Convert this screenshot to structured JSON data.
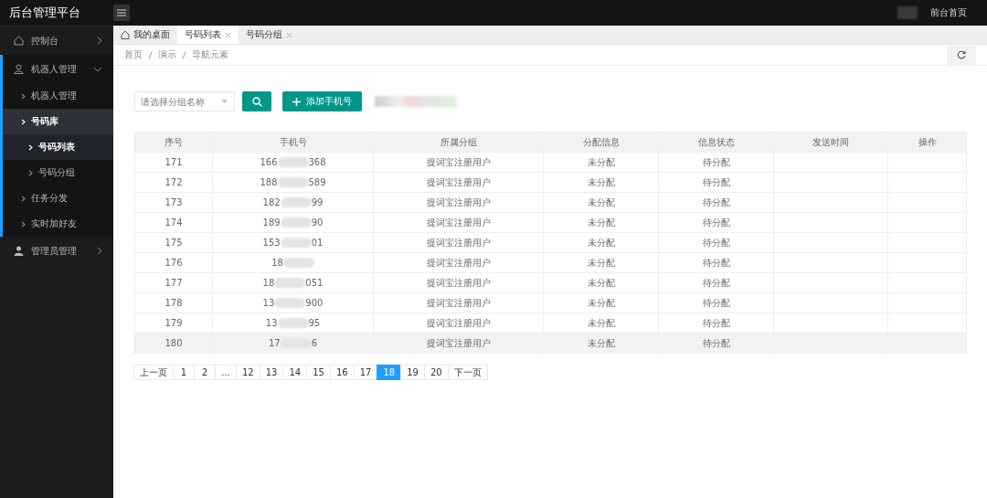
{
  "app": {
    "title": "后台管理平台",
    "top_link": "前台首页"
  },
  "sidebar": {
    "items": [
      {
        "label": "控制台",
        "expanded": false
      },
      {
        "label": "机器人管理",
        "expanded": true,
        "children": [
          {
            "label": "机器人管理",
            "expanded": false
          },
          {
            "label": "号码库",
            "expanded": true,
            "children": [
              {
                "label": "号码列表",
                "selected": true
              },
              {
                "label": "号码分组",
                "selected": false
              }
            ]
          },
          {
            "label": "任务分发",
            "expanded": false
          },
          {
            "label": "实时加好友",
            "expanded": false
          }
        ]
      },
      {
        "label": "管理员管理",
        "expanded": false
      }
    ]
  },
  "tabs": [
    {
      "label": "我的桌面",
      "selected": false,
      "closable": false
    },
    {
      "label": "号码列表",
      "selected": true,
      "closable": true
    },
    {
      "label": "号码分组",
      "selected": false,
      "closable": true
    }
  ],
  "breadcrumb": [
    "首页",
    "演示",
    "导航元素"
  ],
  "toolbar": {
    "group_select": {
      "placeholder": "请选择分组名称"
    },
    "add_button": "添加手机号"
  },
  "table": {
    "columns": [
      "序号",
      "手机号",
      "所属分组",
      "分配信息",
      "信息状态",
      "发送时间",
      "操作"
    ],
    "rows": [
      {
        "no": "171",
        "phone_start": "166",
        "phone_end": "368",
        "group": "提词宝注册用户",
        "assign": "未分配",
        "status": "待分配",
        "highlighted": false
      },
      {
        "no": "172",
        "phone_start": "188",
        "phone_end": "589",
        "group": "提词宝注册用户",
        "assign": "未分配",
        "status": "待分配",
        "highlighted": false
      },
      {
        "no": "173",
        "phone_start": "182",
        "phone_end": "99",
        "group": "提词宝注册用户",
        "assign": "未分配",
        "status": "待分配",
        "highlighted": false
      },
      {
        "no": "174",
        "phone_start": "189",
        "phone_end": "90",
        "group": "提词宝注册用户",
        "assign": "未分配",
        "status": "待分配",
        "highlighted": false
      },
      {
        "no": "175",
        "phone_start": "153",
        "phone_end": "01",
        "group": "提词宝注册用户",
        "assign": "未分配",
        "status": "待分配",
        "highlighted": false
      },
      {
        "no": "176",
        "phone_start": "18",
        "phone_end": "",
        "group": "提词宝注册用户",
        "assign": "未分配",
        "status": "待分配",
        "highlighted": false
      },
      {
        "no": "177",
        "phone_start": "18",
        "phone_end": "051",
        "group": "提词宝注册用户",
        "assign": "未分配",
        "status": "待分配",
        "highlighted": false
      },
      {
        "no": "178",
        "phone_start": "13",
        "phone_end": "900",
        "group": "提词宝注册用户",
        "assign": "未分配",
        "status": "待分配",
        "highlighted": false
      },
      {
        "no": "179",
        "phone_start": "13",
        "phone_end": "95",
        "group": "提词宝注册用户",
        "assign": "未分配",
        "status": "待分配",
        "highlighted": false
      },
      {
        "no": "180",
        "phone_start": "17",
        "phone_end": "6",
        "group": "提词宝注册用户",
        "assign": "未分配",
        "status": "待分配",
        "highlighted": true
      }
    ]
  },
  "pagination": [
    {
      "label": "上一页",
      "selected": false
    },
    {
      "label": "1",
      "selected": false
    },
    {
      "label": "2",
      "selected": false
    },
    {
      "label": "...",
      "selected": false
    },
    {
      "label": "12",
      "selected": false
    },
    {
      "label": "13",
      "selected": false
    },
    {
      "label": "14",
      "selected": false
    },
    {
      "label": "15",
      "selected": false
    },
    {
      "label": "16",
      "selected": false
    },
    {
      "label": "17",
      "selected": false
    },
    {
      "label": "18",
      "selected": true
    },
    {
      "label": "19",
      "selected": false
    },
    {
      "label": "20",
      "selected": false
    },
    {
      "label": "下一页",
      "selected": false
    }
  ]
}
